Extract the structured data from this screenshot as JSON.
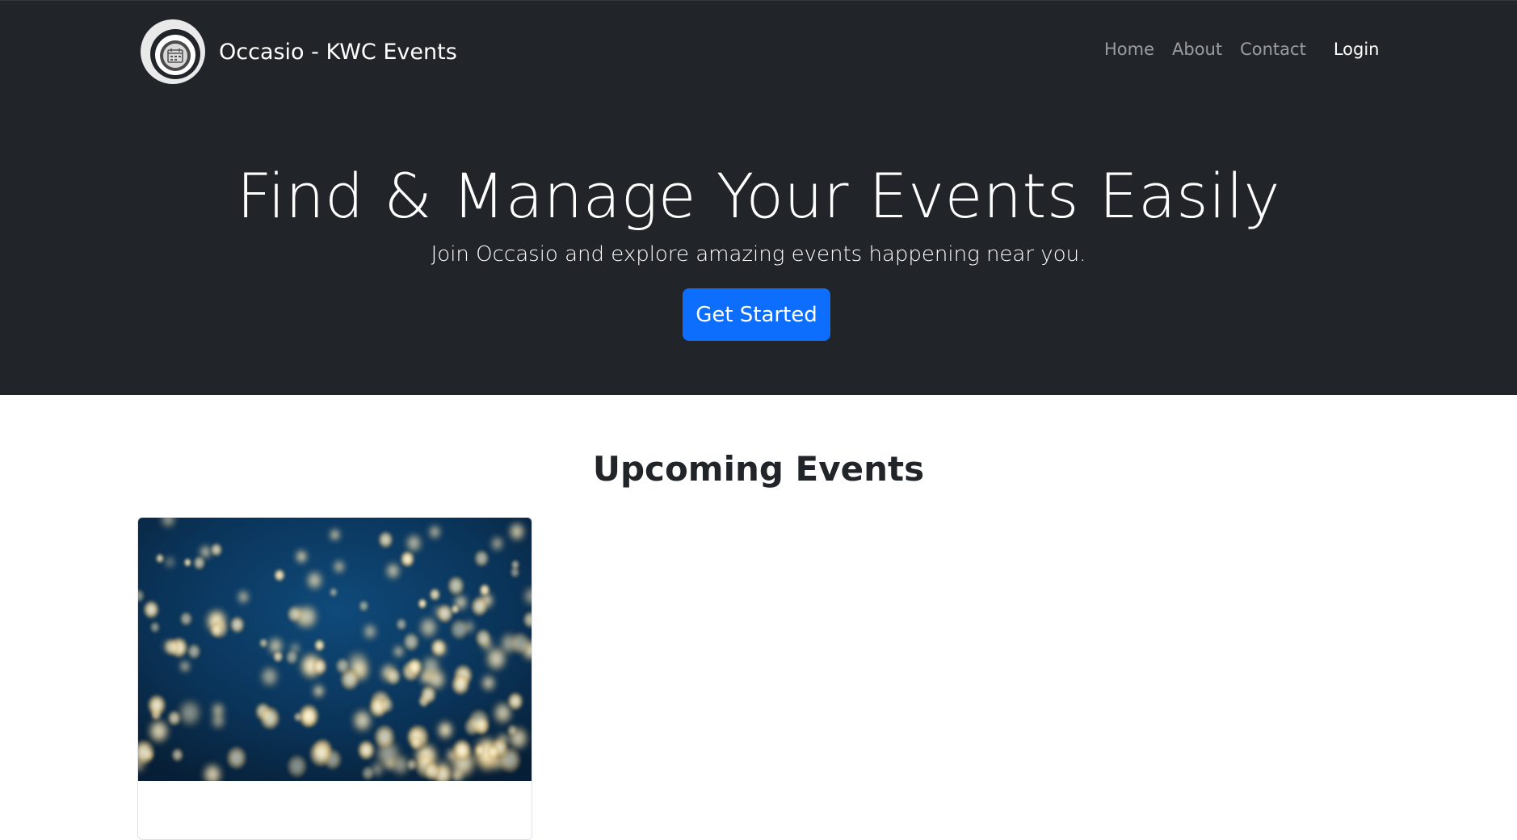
{
  "navbar": {
    "brand_name": "Occasio - KWC Events",
    "logo_icon": "calendar-icon",
    "links": [
      {
        "label": "Home"
      },
      {
        "label": "About"
      },
      {
        "label": "Contact"
      }
    ],
    "login_label": "Login",
    "colors": {
      "background": "#212529",
      "link": "rgba(255,255,255,0.55)",
      "active": "#ffffff"
    }
  },
  "hero": {
    "title": "Find & Manage Your Events Easily",
    "subtitle": "Join Occasio and explore amazing events happening near you.",
    "cta_label": "Get Started",
    "colors": {
      "background": "#212529",
      "cta": "#0d6efd"
    }
  },
  "events": {
    "section_title": "Upcoming Events",
    "cards": [
      {
        "image": "bokeh-lights-image"
      }
    ]
  }
}
